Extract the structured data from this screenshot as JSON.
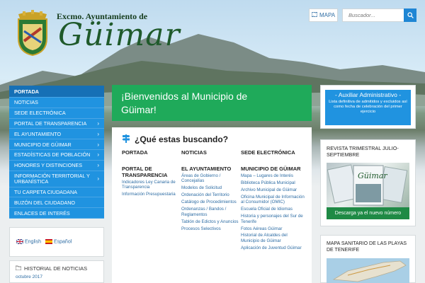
{
  "header": {
    "logo_top": "Excmo. Ayuntamiento de",
    "logo_main": "Güimar",
    "map_label": "MAPA",
    "search_placeholder": "Buscador..."
  },
  "sidebar": {
    "items": [
      {
        "label": "PORTADA",
        "chevron": false
      },
      {
        "label": "NOTICIAS",
        "chevron": false
      },
      {
        "label": "SEDE ELECTRÓNICA",
        "chevron": false
      },
      {
        "label": "PORTAL DE TRANSPARENCIA",
        "chevron": true
      },
      {
        "label": "EL AYUNTAMIENTO",
        "chevron": true
      },
      {
        "label": "MUNICIPIO DE GÜIMAR",
        "chevron": true
      },
      {
        "label": "ESTADÍSTICAS DE POBLACIÓN",
        "chevron": true
      },
      {
        "label": "HONORES Y DISTINCIONES",
        "chevron": true
      },
      {
        "label": "INFORMACIÓN TERRITORIAL Y URBANÍSTICA",
        "chevron": true
      },
      {
        "label": "TU CARPETA CIUDADANA",
        "chevron": false
      },
      {
        "label": "BUZÓN DEL CIUDADANO",
        "chevron": false
      },
      {
        "label": "ENLACES DE INTERÉS",
        "chevron": false
      }
    ],
    "chevron_glyph": "›"
  },
  "languages": {
    "english": "English",
    "spanish": "Español"
  },
  "history": {
    "title": "HISTORIAL DE NOTICIAS",
    "month": "octubre 2017"
  },
  "welcome": {
    "line1": "¡Bienvenidos al Municipio de",
    "line2": "Güimar!"
  },
  "search_section": {
    "title": "¿Qué estas buscando?",
    "col1": {
      "heading": "PORTADA",
      "heading2": "PORTAL DE TRANSPARENCIA",
      "links": [
        "Indicadores Ley Canaria de Transparencia",
        "Información Presupuestaria"
      ]
    },
    "col2": {
      "heading": "NOTICIAS",
      "heading2": "EL AYUNTAMIENTO",
      "links": [
        "Áreas de Gobierno / Concejalías",
        "Modelos de Solicitud",
        "Ordenación del Territorio",
        "Catálogo de Procedimientos",
        "Ordenanzas / Bandos / Reglamentos",
        "Tablón de Edictos y Anuncios",
        "Procesos Selectivos"
      ]
    },
    "col3": {
      "heading": "SEDE ELECTRÓNICA",
      "heading2": "MUNICIPIO DE GÜIMAR",
      "links": [
        "Mapa – Lugares de Interés",
        "Biblioteca Pública Municipal",
        "Archivo Municipal de Güimar",
        "Oficina Municipal de Información al Consumidor (OMIC)",
        "Escuela Oficial de Idiomas",
        "Historia y personajes del Sur de Tenerife",
        "Fotos Aéreas Güimar",
        "Historial de Alcaldes del Municipio de Güimar",
        "Aplicación de Juventud Güimar"
      ]
    }
  },
  "aux": {
    "title": "- Auxiliar Administrativo -",
    "desc": "Lista definitiva de admitidos y excluidos así como fecha de celebración del primer ejercicio"
  },
  "revista": {
    "title": "REVISTA TRIMESTRAL JULIO-SEPTIEMBRE",
    "cover_text": "Güimar",
    "button": "Descarga ya el nuevo número"
  },
  "mapa_sanitario": {
    "title": "MAPA SANITARIO DE LAS PLAYAS DE TENERIFE"
  },
  "colors": {
    "primary_blue": "#2093e0",
    "green": "#1faa5a"
  }
}
